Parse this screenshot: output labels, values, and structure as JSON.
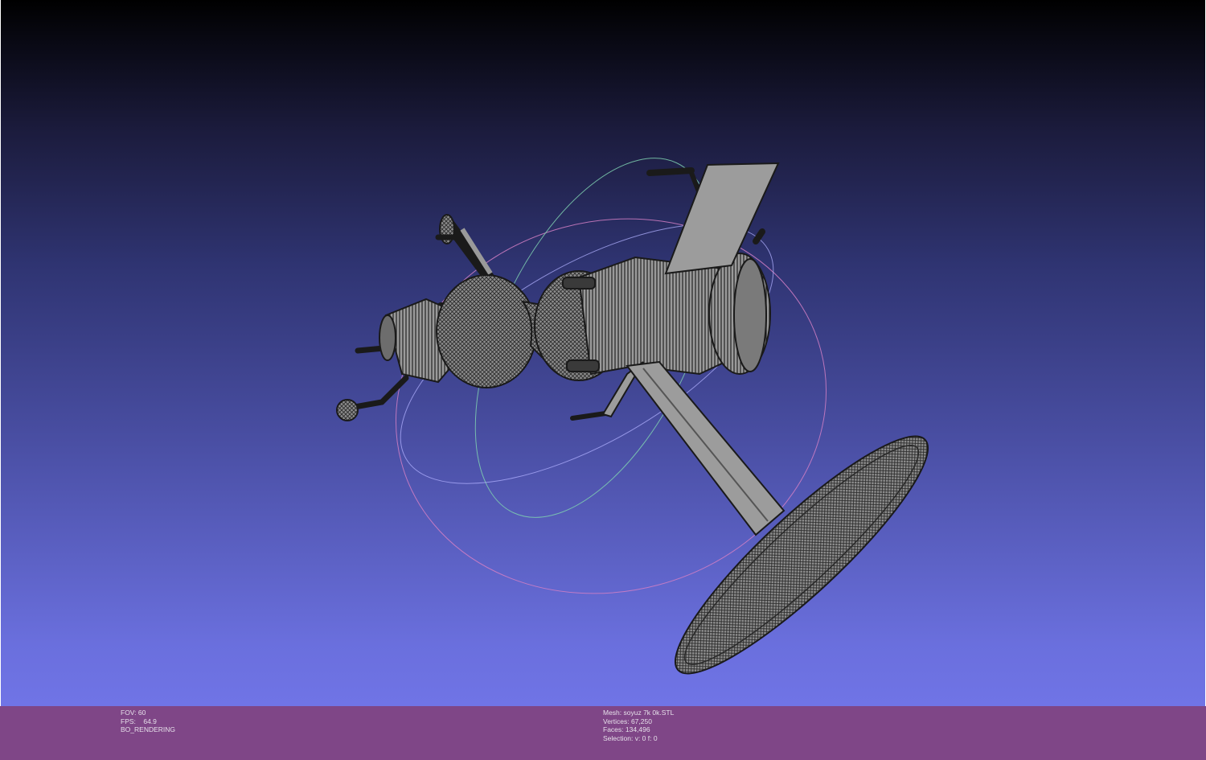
{
  "viewer": {
    "background_top_color": "#000000",
    "background_bottom_color": "#7074e6",
    "mesh_color": "#8a8a8a",
    "wire_color": "#1c1c1c",
    "trackball_colors": [
      "#d070c0",
      "#70d0a0",
      "#a0a0ff"
    ]
  },
  "status_bar": {
    "background_color": "#7f4687",
    "left": {
      "fov": "FOV: 60",
      "fps": "FPS:    64.9",
      "render_mode": "BO_RENDERING"
    },
    "right": {
      "mesh": "Mesh: soyuz 7k 0k.STL",
      "vertices": "Vertices: 67,250",
      "faces": "Faces: 134,496",
      "selection": "Selection: v: 0 f: 0"
    }
  }
}
